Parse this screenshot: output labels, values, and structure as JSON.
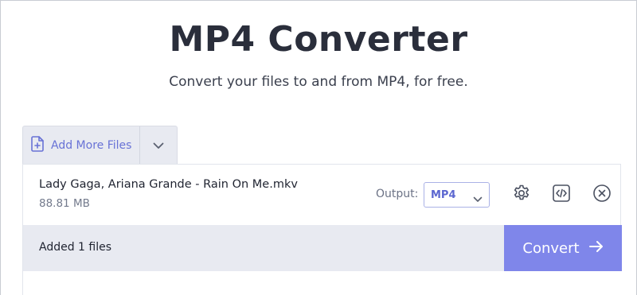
{
  "header": {
    "title": "MP4 Converter",
    "subtitle": "Convert your files to and from MP4, for free."
  },
  "uploader": {
    "add_more_label": "Add More Files",
    "file": {
      "name": "Lady Gaga, Ariana Grande - Rain On Me.mkv",
      "size": "88.81 MB",
      "output_label": "Output:",
      "output_value": "MP4"
    },
    "status_text": "Added 1 files",
    "convert_label": "Convert"
  },
  "colors": {
    "accent": "#7f86ea",
    "accent_text": "#5c67d0",
    "panel_bg": "#e8eaf1",
    "title": "#2a2e3b"
  },
  "icons": {
    "add_file": "file-plus-icon",
    "dropdown": "chevron-down-icon",
    "settings": "gear-icon",
    "embed": "code-icon",
    "remove": "close-circle-icon",
    "convert": "arrow-right-icon"
  }
}
